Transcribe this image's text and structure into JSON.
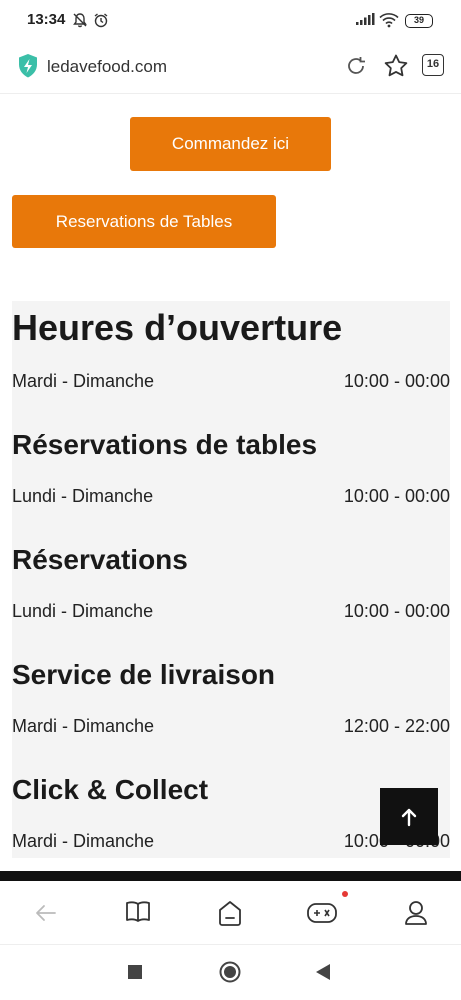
{
  "status": {
    "time": "13:34",
    "battery": "39",
    "icons": [
      "mute-icon",
      "alarm-icon",
      "signal-icon",
      "wifi-icon",
      "battery-icon"
    ]
  },
  "browser": {
    "url": "ledavefood.com",
    "tab_count": "16",
    "icons": [
      "shield-lightning-icon",
      "reload-icon",
      "star-icon",
      "tabs-icon"
    ]
  },
  "buttons": {
    "order": "Commandez ici",
    "reserve_tables": "Reservations de Tables"
  },
  "hours": {
    "title": "Heures d’ouverture",
    "title_rows": [
      {
        "days": "Mardi - Dimanche",
        "time": "10:00 - 00:00"
      }
    ],
    "sections": [
      {
        "title": "Réservations de tables",
        "days": "Lundi - Dimanche",
        "time": "10:00 - 00:00"
      },
      {
        "title": "Réservations",
        "days": "Lundi - Dimanche",
        "time": "10:00 - 00:00"
      },
      {
        "title": "Service de livraison",
        "days": "Mardi - Dimanche",
        "time": "12:00 - 22:00"
      },
      {
        "title": "Click & Collect",
        "days": "Mardi - Dimanche",
        "time": "10:00 - 00:00"
      }
    ]
  },
  "bottom_nav": {
    "icons": [
      "back-arrow-icon",
      "book-icon",
      "home-icon",
      "gamepad-icon",
      "profile-icon"
    ]
  },
  "system_nav": {
    "icons": [
      "recents-square-icon",
      "home-circle-icon",
      "back-triangle-icon"
    ]
  },
  "colors": {
    "accent": "#e8780a",
    "panel": "#f4f4f4",
    "notification_dot": "#e53935"
  }
}
